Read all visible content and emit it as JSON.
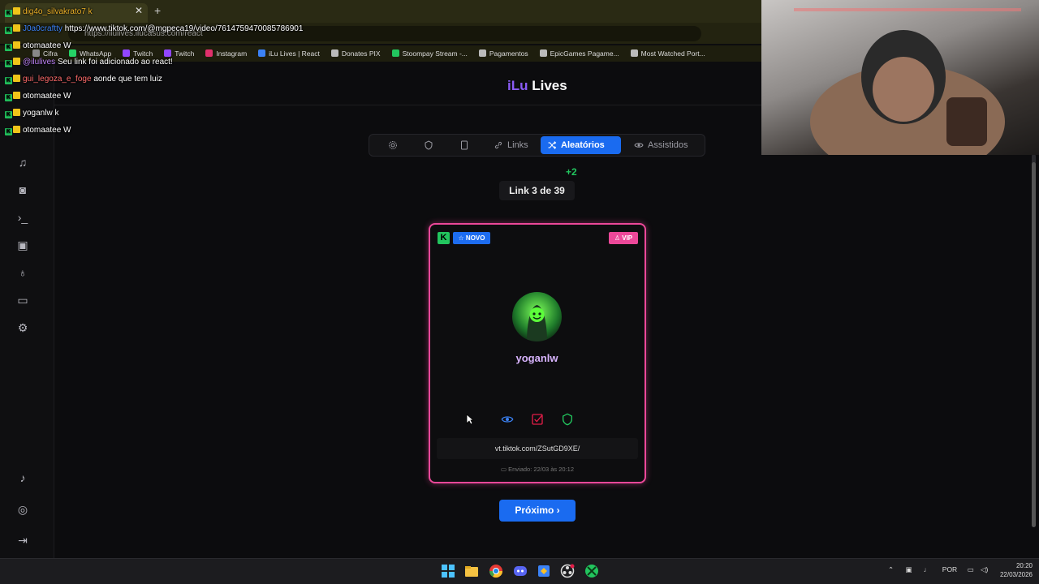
{
  "browser": {
    "tab_title": "dig4o_silvakrato7 k",
    "new_tab_label": "+",
    "close_label": "✕",
    "url": "https://ilulives.ilucasus.com/react",
    "bookmarks": [
      "Cifra",
      "WhatsApp",
      "Twitch",
      "Twitch",
      "Instagram",
      "iLu Lives | React",
      "Donates PIX",
      "Stoompay Stream -...",
      "Pagamentos",
      "EpicGames Pagame...",
      "Most Watched Port..."
    ]
  },
  "app": {
    "logo_prefix": "iLu",
    "logo_suffix": "Lives",
    "tabs": [
      {
        "label": "",
        "icon": "gear-icon"
      },
      {
        "label": "",
        "icon": "shield-icon"
      },
      {
        "label": "",
        "icon": "tablet-icon"
      },
      {
        "label": "Links",
        "icon": "link-icon"
      },
      {
        "label": "Aleatórios",
        "icon": "shuffle-icon"
      },
      {
        "label": "Assistidos",
        "icon": "eye-icon"
      }
    ],
    "new_count": "+2",
    "counter": "Link 3 de 39",
    "card": {
      "platform_badge": "K",
      "novo_badge": "NOVO",
      "vip_badge": "VIP",
      "username": "yoganlw",
      "link": "vt.tiktok.com/ZSutGD9XE/",
      "sent": "Enviado: 22/03 às 20:12",
      "accent": "#ec4899"
    },
    "next_button": "Próximo ›"
  },
  "chat": [
    {
      "user": "",
      "text": "dig4o_silvakrato7 k"
    },
    {
      "user": "J0a0craftty",
      "text": "https://www.tiktok.com/@mgpeca19/video/7614759470085786901"
    },
    {
      "user": "otomaatee",
      "text": "W"
    },
    {
      "user": "@ilulives",
      "text": "Seu link foi adicionado ao react!"
    },
    {
      "user": "gui_legoza_e_foge",
      "text": "aonde que tem luiz"
    },
    {
      "user": "otomaatee",
      "text": "W"
    },
    {
      "user": "yoganlw",
      "text": "k"
    },
    {
      "user": "otomaatee",
      "text": "W"
    }
  ],
  "taskbar": {
    "language": "POR",
    "time": "20:20",
    "date": "22/03/2026"
  }
}
